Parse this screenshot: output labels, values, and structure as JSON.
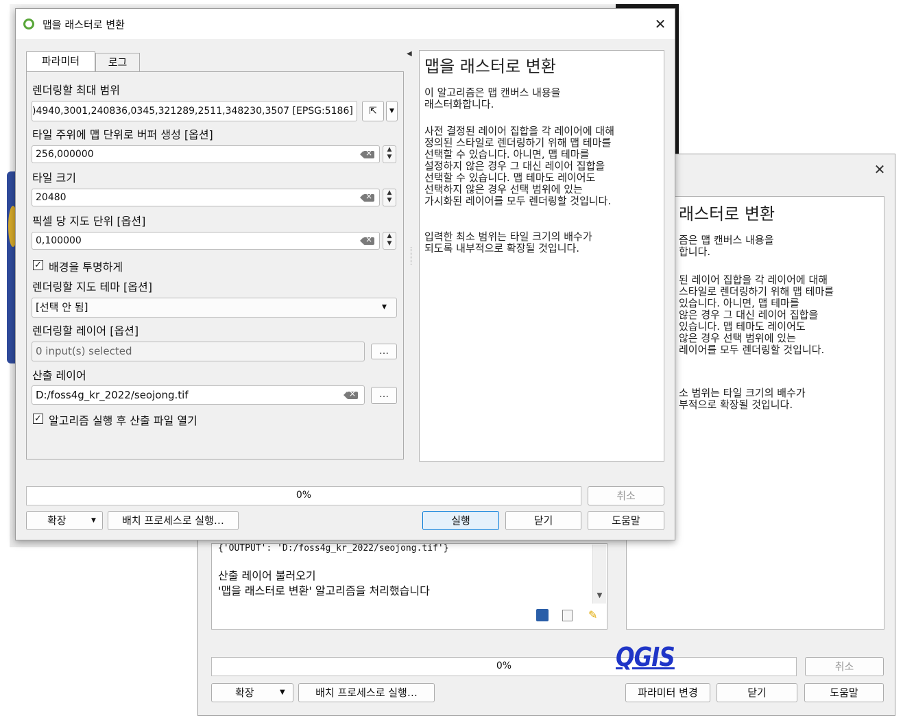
{
  "front": {
    "title": "맵을 래스터로 변환",
    "tabs": [
      "파라미터",
      "로그"
    ],
    "extent_label": "렌더링할 최대 범위",
    "extent_value": ")4940,3001,240836,0345,321289,2511,348230,3507 [EPSG:5186]",
    "buffer_label": "타일 주위에 맵 단위로 버퍼 생성 [옵션]",
    "buffer_value": "256,000000",
    "tile_label": "타일 크기",
    "tile_value": "20480",
    "mupp_label": "픽셀 당 지도 단위 [옵션]",
    "mupp_value": "0,100000",
    "transparent_label": "배경을 투명하게",
    "theme_label": "렌더링할 지도 테마 [옵션]",
    "theme_value": "[선택 안 됨]",
    "layers_label": "렌더링할 레이어 [옵션]",
    "layers_value": "0 input(s) selected",
    "output_label": "산출 레이어",
    "output_value": "D:/foss4g_kr_2022/seojong.tif",
    "open_label": "알고리즘 실행 후 산출 파일 열기",
    "dots": "…",
    "help_title": "맵을 래스터로 변환",
    "help_p1": "이 알고리즘은 맵 캔버스 내용을\n래스터화합니다.",
    "help_p2": "사전 결정된 레이어 집합을 각 레이어에 대해\n정의된 스타일로 렌더링하기 위해 맵 테마를\n선택할 수 있습니다. 아니면, 맵 테마를\n설정하지 않은 경우 그 대신 레이어 집합을\n선택할 수 있습니다. 맵 테마도 레이어도\n선택하지 않은 경우 선택 범위에 있는\n가시화된 레이어를 모두 렌더링할 것입니다.",
    "help_p3": "입력한 최소 범위는 타일 크기의 배수가\n되도록 내부적으로 확장될 것입니다.",
    "progress": "0%",
    "cancel": "취소",
    "expand": "확장",
    "batch": "배치 프로세스로 실행…",
    "run": "실행",
    "close": "닫기",
    "help": "도움말"
  },
  "back": {
    "log_line1": "{'OUTPUT': 'D:/foss4g_kr_2022/seojong.tif'}",
    "log_line2": "산출 레이어 불러오기",
    "log_line3": "'맵을 래스터로 변환' 알고리즘을 처리했습니다",
    "help_title": "래스터로 변환",
    "help_p1": "즘은 맵 캔버스 내용을\n합니다.",
    "help_p2": "된 레이어 집합을 각 레이어에 대해\n스타일로 렌더링하기 위해 맵 테마를\n 있습니다. 아니면, 맵 테마를\n않은 경우 그 대신 레이어 집합을\n 있습니다. 맵 테마도 레이어도\n않은 경우 선택 범위에 있는\n레이어를 모두 렌더링할 것입니다.",
    "help_p3": "소 범위는 타일 크기의 배수가\n부적으로 확장될 것입니다.",
    "progress": "0%",
    "cancel": "취소",
    "expand": "확장",
    "batch": "배치 프로세스로 실행…",
    "change_params": "파라미터 변경",
    "close": "닫기",
    "help": "도움말"
  },
  "logo_text": "QGIS",
  "close_glyph": "✕"
}
